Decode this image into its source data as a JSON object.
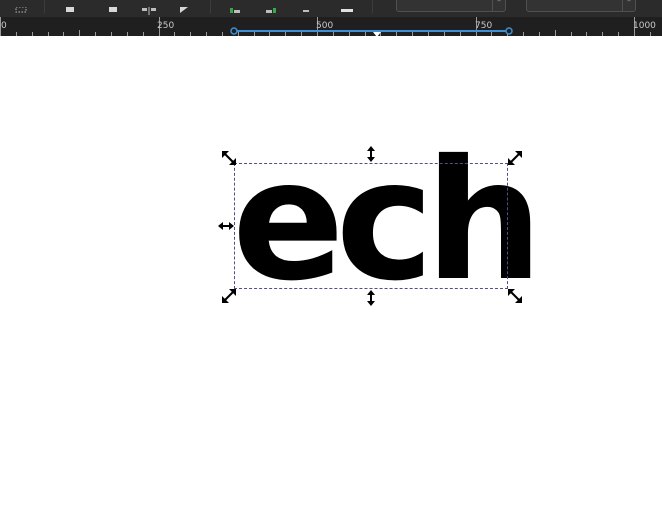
{
  "ruler": {
    "labels": [
      "0",
      "250",
      "500",
      "750",
      "1000"
    ]
  },
  "canvas": {
    "text_object": "ech",
    "text_color": "#000000",
    "selection_color": "#5a4a8a"
  },
  "theme": {
    "accent": "#3d8fd6",
    "toolbar_bg": "#2b2b2b",
    "ruler_bg": "#1f1f1f"
  }
}
